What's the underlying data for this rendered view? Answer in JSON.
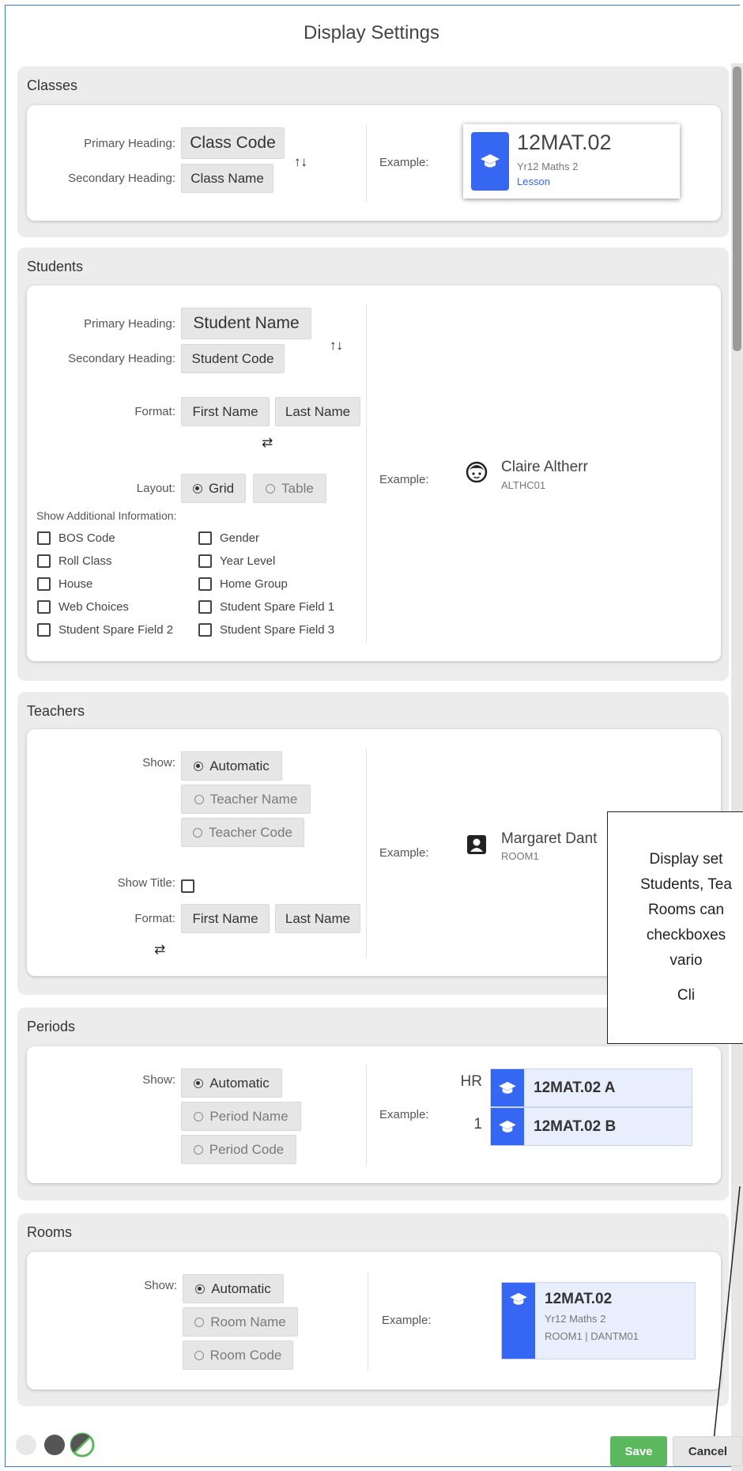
{
  "dialog": {
    "title": "Display Settings"
  },
  "common": {
    "primary_heading": "Primary Heading:",
    "secondary_heading": "Secondary Heading:",
    "example": "Example:",
    "format": "Format:",
    "show": "Show:",
    "first_name": "First Name",
    "last_name": "Last Name",
    "automatic": "Automatic"
  },
  "classes": {
    "title": "Classes",
    "primary_value": "Class Code",
    "secondary_value": "Class Name",
    "example": {
      "code": "12MAT.02",
      "name": "Yr12 Maths 2",
      "type": "Lesson"
    }
  },
  "students": {
    "title": "Students",
    "primary_value": "Student Name",
    "secondary_value": "Student Code",
    "layout_label": "Layout:",
    "layout_grid": "Grid",
    "layout_table": "Table",
    "additional_label": "Show Additional Information:",
    "checkboxes": [
      "BOS Code",
      "Gender",
      "Roll Class",
      "Year Level",
      "House",
      "Home Group",
      "Web Choices",
      "Student Spare Field 1",
      "Student Spare Field 2",
      "Student Spare Field 3"
    ],
    "example": {
      "name": "Claire Altherr",
      "code": "ALTHC01"
    }
  },
  "teachers": {
    "title": "Teachers",
    "opt_name": "Teacher Name",
    "opt_code": "Teacher Code",
    "show_title": "Show Title:",
    "example": {
      "name": "Margaret Dant",
      "room": "ROOM1"
    }
  },
  "periods": {
    "title": "Periods",
    "opt_name": "Period Name",
    "opt_code": "Period Code",
    "example": {
      "rows": [
        {
          "period": "HR",
          "label": "12MAT.02 A"
        },
        {
          "period": "1",
          "label": "12MAT.02 B"
        }
      ]
    }
  },
  "rooms": {
    "title": "Rooms",
    "opt_name": "Room Name",
    "opt_code": "Room Code",
    "example": {
      "code": "12MAT.02",
      "name": "Yr12 Maths 2",
      "detail": "ROOM1 | DANTM01"
    }
  },
  "callout": {
    "lines": [
      "Display set",
      "Students, Tea",
      "Rooms can",
      "checkboxes",
      "vario",
      "",
      "Cli"
    ]
  },
  "footer": {
    "save": "Save",
    "cancel": "Cancel"
  },
  "colors": {
    "accent": "#3567f3",
    "save": "#5cb85c",
    "link": "#3567f3",
    "frame": "#3f78c8"
  }
}
